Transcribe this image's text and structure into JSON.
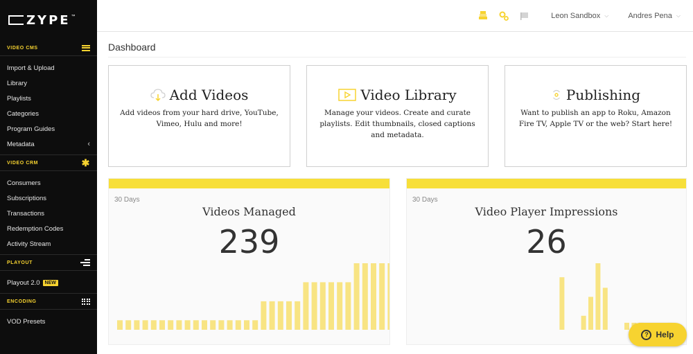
{
  "brand": {
    "logo_text": "ZYPE",
    "logo_tm": "™"
  },
  "sidebar": {
    "sections": [
      {
        "title": "VIDEO CMS",
        "icon": "hamburger-icon",
        "items": [
          {
            "label": "Import & Upload"
          },
          {
            "label": "Library"
          },
          {
            "label": "Playlists"
          },
          {
            "label": "Categories"
          },
          {
            "label": "Program Guides"
          },
          {
            "label": "Metadata",
            "chevron": "‹"
          }
        ]
      },
      {
        "title": "VIDEO CRM",
        "icon": "asterisk-icon",
        "icon_glyph": "✱",
        "items": [
          {
            "label": "Consumers"
          },
          {
            "label": "Subscriptions"
          },
          {
            "label": "Transactions"
          },
          {
            "label": "Redemption Codes"
          },
          {
            "label": "Activity Stream"
          }
        ]
      },
      {
        "title": "PLAYOUT",
        "icon": "playout-icon",
        "items": [
          {
            "label": "Playout 2.0",
            "badge": "NEW"
          }
        ]
      },
      {
        "title": "ENCODING",
        "icon": "grid-icon",
        "items": [
          {
            "label": "VOD Presets"
          }
        ]
      }
    ]
  },
  "header": {
    "icons": [
      "stack-icon",
      "gears-icon",
      "flag-icon"
    ],
    "account_select": "Leon Sandbox",
    "user_select": "Andres Pena"
  },
  "main": {
    "title": "Dashboard",
    "cards": [
      {
        "title": "Add Videos",
        "icon": "cloud-upload-icon",
        "description": "Add videos from your hard drive, YouTube, Vimeo, Hulu and more!"
      },
      {
        "title": "Video Library",
        "icon": "play-box-icon",
        "description": "Manage your videos. Create and curate playlists. Edit thumbnails, closed captions and metadata."
      },
      {
        "title": "Publishing",
        "icon": "broadcast-icon",
        "description": "Want to publish an app to Roku, Amazon Fire TV, Apple TV or the web? Start here!"
      }
    ],
    "stats": [
      {
        "period": "30 Days",
        "label": "Videos Managed",
        "value": "239"
      },
      {
        "period": "30 Days",
        "label": "Video Player Impressions",
        "value": "26"
      }
    ]
  },
  "help": {
    "label": "Help"
  },
  "colors": {
    "accent": "#f7d330",
    "sidebar_bg": "#0d0d0d",
    "bar_fill": "#f8e483"
  },
  "chart_data": [
    {
      "type": "bar",
      "title": "Videos Managed",
      "values": [
        2,
        2,
        2,
        2,
        2,
        2,
        2,
        2,
        2,
        2,
        2,
        2,
        2,
        2,
        2,
        2,
        2,
        6,
        6,
        6,
        6,
        6,
        10,
        10,
        10,
        10,
        10,
        10,
        14,
        14,
        14,
        14,
        14,
        14
      ]
    },
    {
      "type": "bar",
      "title": "Video Player Impressions",
      "values": [
        0,
        0,
        0,
        0,
        0,
        0,
        0,
        0,
        0,
        0,
        0,
        0,
        0,
        0,
        0,
        0,
        0,
        0,
        0,
        0,
        0,
        7.5,
        0,
        0,
        2.0,
        4.7,
        9.5,
        6.0,
        0,
        0,
        1.0,
        1.0,
        1.0,
        0,
        0,
        0,
        1.0
      ]
    }
  ]
}
